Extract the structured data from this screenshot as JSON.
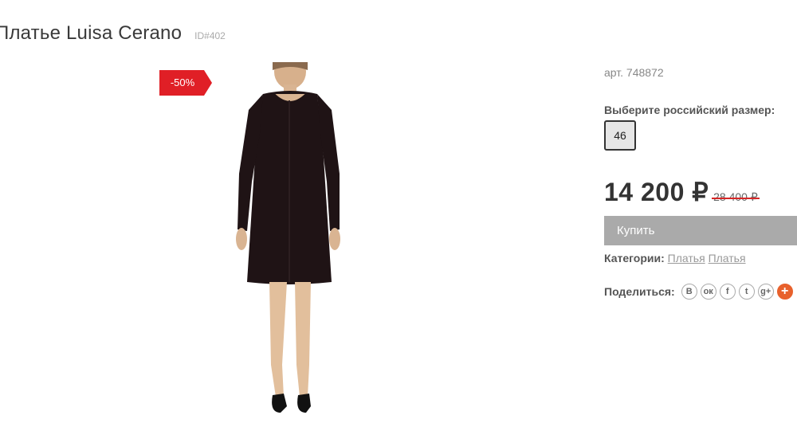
{
  "product": {
    "title": "Платье Luisa Cerano",
    "id_label": "ID#402",
    "sale_badge": "-50%",
    "sku": "арт. 748872",
    "size_label": "Выберите российский размер:",
    "size_value": "46",
    "price": "14 200 ₽",
    "old_price": "28 400 ₽",
    "buy_label": "Купить",
    "categories_label": "Категории:",
    "categories": [
      "Платья",
      "Платья"
    ],
    "share_label": "Поделиться:",
    "share_icons": [
      {
        "name": "vk-icon",
        "glyph": "B"
      },
      {
        "name": "odnoklassniki-icon",
        "glyph": "ок"
      },
      {
        "name": "facebook-icon",
        "glyph": "f"
      },
      {
        "name": "twitter-icon",
        "glyph": "t"
      },
      {
        "name": "google-plus-icon",
        "glyph": "g+"
      },
      {
        "name": "more-share-icon",
        "glyph": "+"
      }
    ]
  },
  "colors": {
    "sale": "#e01f26",
    "buy_button": "#aaaaaa",
    "old_price_strike": "#d62727"
  }
}
